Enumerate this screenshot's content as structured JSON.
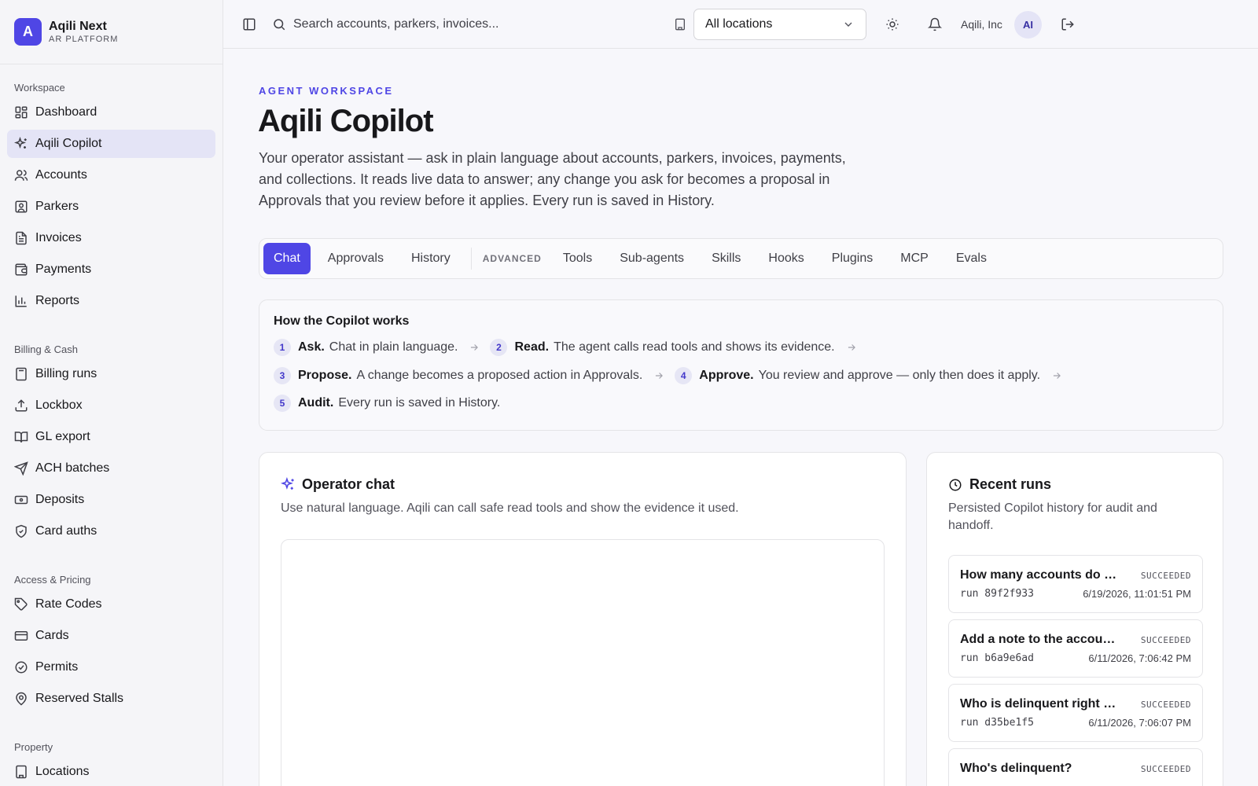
{
  "brand": {
    "logo_letter": "A",
    "name": "Aqili Next",
    "subtitle": "AR PLATFORM"
  },
  "sidebar": {
    "sections": [
      {
        "heading": "Workspace",
        "items": [
          {
            "label": "Dashboard",
            "icon": "dashboard-icon"
          },
          {
            "label": "Aqili Copilot",
            "icon": "sparkles-icon",
            "active": true
          },
          {
            "label": "Accounts",
            "icon": "users-icon"
          },
          {
            "label": "Parkers",
            "icon": "contact-icon"
          },
          {
            "label": "Invoices",
            "icon": "file-text-icon"
          },
          {
            "label": "Payments",
            "icon": "wallet-icon"
          },
          {
            "label": "Reports",
            "icon": "bar-chart-icon"
          }
        ]
      },
      {
        "heading": "Billing & Cash",
        "items": [
          {
            "label": "Billing runs",
            "icon": "calculator-icon"
          },
          {
            "label": "Lockbox",
            "icon": "upload-icon"
          },
          {
            "label": "GL export",
            "icon": "book-icon"
          },
          {
            "label": "ACH batches",
            "icon": "send-icon"
          },
          {
            "label": "Deposits",
            "icon": "banknote-icon"
          },
          {
            "label": "Card auths",
            "icon": "shield-icon"
          }
        ]
      },
      {
        "heading": "Access & Pricing",
        "items": [
          {
            "label": "Rate Codes",
            "icon": "tag-icon"
          },
          {
            "label": "Cards",
            "icon": "credit-card-icon"
          },
          {
            "label": "Permits",
            "icon": "badge-check-icon"
          },
          {
            "label": "Reserved Stalls",
            "icon": "map-pin-icon"
          }
        ]
      },
      {
        "heading": "Property",
        "items": [
          {
            "label": "Locations",
            "icon": "building-icon"
          }
        ]
      }
    ]
  },
  "topbar": {
    "search_placeholder": "Search accounts, parkers, invoices...",
    "location": "All locations",
    "org": "Aqili, Inc",
    "avatar_initials": "AI"
  },
  "page": {
    "eyebrow": "AGENT WORKSPACE",
    "title": "Aqili Copilot",
    "description": "Your operator assistant — ask in plain language about accounts, parkers, invoices, payments, and collections. It reads live data to answer; any change you ask for becomes a proposal in Approvals that you review before it applies. Every run is saved in History."
  },
  "tabs": {
    "primary": [
      "Chat",
      "Approvals",
      "History"
    ],
    "advanced_label": "ADVANCED",
    "advanced": [
      "Tools",
      "Sub-agents",
      "Skills",
      "Hooks",
      "Plugins",
      "MCP",
      "Evals"
    ],
    "active": "Chat"
  },
  "how": {
    "title": "How the Copilot works",
    "steps": [
      {
        "num": "1",
        "name": "Ask.",
        "text": "Chat in plain language."
      },
      {
        "num": "2",
        "name": "Read.",
        "text": "The agent calls read tools and shows its evidence."
      },
      {
        "num": "3",
        "name": "Propose.",
        "text": "A change becomes a proposed action in Approvals."
      },
      {
        "num": "4",
        "name": "Approve.",
        "text": "You review and approve — only then does it apply."
      },
      {
        "num": "5",
        "name": "Audit.",
        "text": "Every run is saved in History."
      }
    ]
  },
  "chat": {
    "title": "Operator chat",
    "description": "Use natural language. Aqili can call safe read tools and show the evidence it used."
  },
  "runs": {
    "title": "Recent runs",
    "description": "Persisted Copilot history for audit and handoff.",
    "items": [
      {
        "question": "How many accounts do we have?",
        "status": "SUCCEEDED",
        "id": "run 89f2f933",
        "time": "6/19/2026, 11:01:51 PM"
      },
      {
        "question": "Add a note to the account ...",
        "status": "SUCCEEDED",
        "id": "run b6a9e6ad",
        "time": "6/11/2026, 7:06:42 PM"
      },
      {
        "question": "Who is delinquent right now?",
        "status": "SUCCEEDED",
        "id": "run d35be1f5",
        "time": "6/11/2026, 7:06:07 PM"
      },
      {
        "question": "Who's delinquent?",
        "status": "SUCCEEDED",
        "id": "",
        "time": ""
      }
    ]
  },
  "colors": {
    "accent": "#4f46e5",
    "active_nav": "#e4e4f6"
  }
}
